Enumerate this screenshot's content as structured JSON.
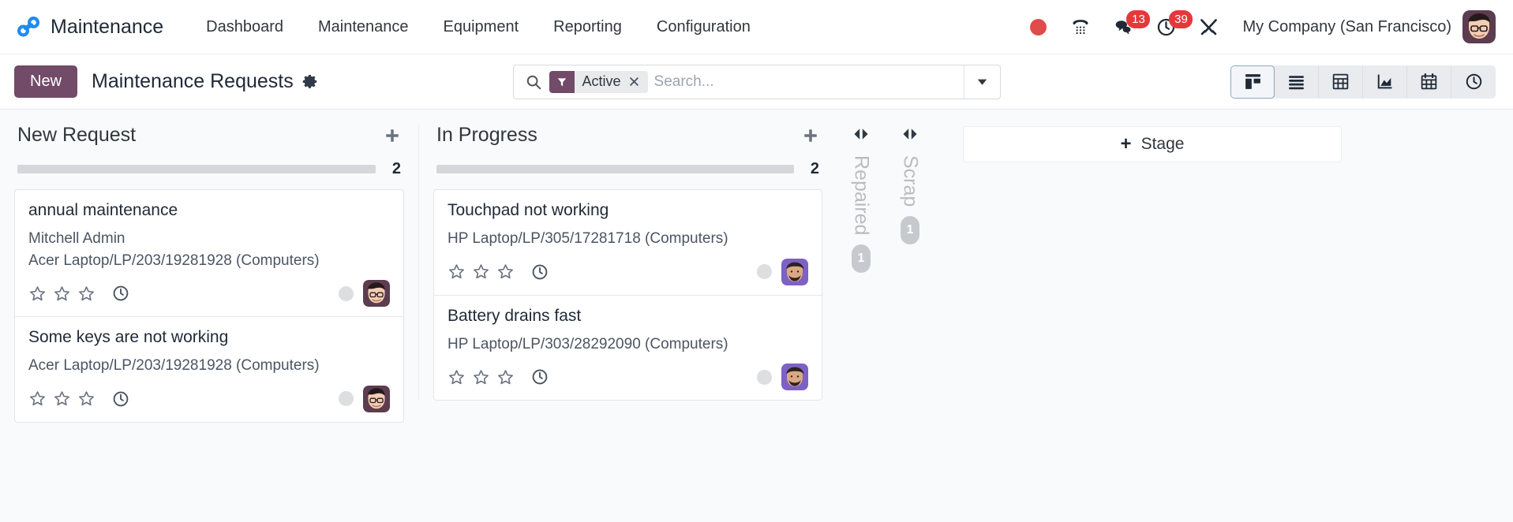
{
  "navbar": {
    "logo_icon": "maintenance-chain-logo",
    "brand": "Maintenance",
    "menu": [
      {
        "label": "Dashboard"
      },
      {
        "label": "Maintenance"
      },
      {
        "label": "Equipment"
      },
      {
        "label": "Reporting"
      },
      {
        "label": "Configuration"
      }
    ],
    "systray": {
      "record_dot_icon": "record-dot-icon",
      "phone_icon": "phone-dialpad-icon",
      "messages_icon": "messages-bubble-icon",
      "messages_count": "13",
      "activities_icon": "activities-clock-icon",
      "activities_count": "39",
      "apps_icon": "tools-icon"
    },
    "company": "My Company (San Francisco)",
    "user_avatar_icon": "user-avatar"
  },
  "control_panel": {
    "new_label": "New",
    "title": "Maintenance Requests",
    "gear_icon": "gear-icon",
    "search": {
      "search_icon": "search-icon",
      "facet_icon": "filter-funnel-icon",
      "facet_label": "Active",
      "facet_remove_icon": "close-icon",
      "placeholder": "Search...",
      "caret_icon": "chevron-down-icon"
    },
    "views": [
      {
        "name": "kanban",
        "icon": "kanban-icon",
        "active": true
      },
      {
        "name": "list",
        "icon": "list-icon",
        "active": false
      },
      {
        "name": "pivot",
        "icon": "pivot-table-icon",
        "active": false
      },
      {
        "name": "graph",
        "icon": "graph-area-icon",
        "active": false
      },
      {
        "name": "calendar",
        "icon": "calendar-icon",
        "active": false
      },
      {
        "name": "activity",
        "icon": "activity-clock-icon",
        "active": false
      }
    ]
  },
  "kanban": {
    "columns": [
      {
        "title": "New Request",
        "count": "2",
        "add_icon": "plus-icon",
        "cards": [
          {
            "title": "annual maintenance",
            "owner": "Mitchell Admin",
            "equipment": "Acer Laptop/LP/203/19281928 (Computers)",
            "priority": 0,
            "clock_icon": "clock-icon",
            "status_dot": "status-dot-grey",
            "avatar": "avatar-mitchell"
          },
          {
            "title": "Some keys are not working",
            "owner": "",
            "equipment": "Acer Laptop/LP/203/19281928 (Computers)",
            "priority": 0,
            "clock_icon": "clock-icon",
            "status_dot": "status-dot-grey",
            "avatar": "avatar-mitchell"
          }
        ]
      },
      {
        "title": "In Progress",
        "count": "2",
        "add_icon": "plus-icon",
        "cards": [
          {
            "title": "Touchpad not working",
            "owner": "",
            "equipment": "HP Laptop/LP/305/17281718 (Computers)",
            "priority": 0,
            "clock_icon": "clock-icon",
            "status_dot": "status-dot-grey",
            "avatar": "avatar-marc"
          },
          {
            "title": "Battery drains fast",
            "owner": "",
            "equipment": "HP Laptop/LP/303/28292090 (Computers)",
            "priority": 0,
            "clock_icon": "clock-icon",
            "status_dot": "status-dot-grey",
            "avatar": "avatar-marc"
          }
        ]
      }
    ],
    "folded_columns": [
      {
        "title": "Repaired",
        "count": "1",
        "toggle_icon": "expand-arrows-icon"
      },
      {
        "title": "Scrap",
        "count": "1",
        "toggle_icon": "expand-arrows-icon"
      }
    ],
    "add_stage": {
      "label": "Stage",
      "plus": "+"
    }
  },
  "colors": {
    "accent_purple": "#714b67",
    "badge_red": "#e5383b",
    "logo_blue": "#1f8ced",
    "page_bg": "#f9fafb",
    "text_dark": "#31373d"
  }
}
